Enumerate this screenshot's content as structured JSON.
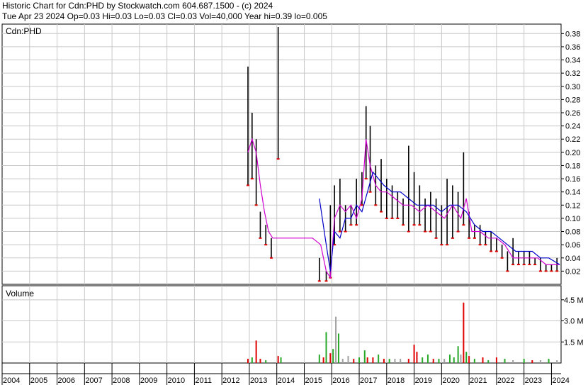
{
  "header": {
    "line1": "Historic Chart for Cdn:PHD by Stockwatch.com 604.687.1500 - (c) 2024",
    "line2": "Tue Apr 23 2024  Op=0.03  Hi=0.03  Lo=0.03  Cl=0.03  Vol=40,000  Year hi=0.39  lo=0.005"
  },
  "colors": {
    "grid": "#c8c8c8",
    "price_bar": "#000000",
    "down_marker": "#e00000",
    "ma_short": "#d000d0",
    "ma_long": "#0000c8",
    "vol_up": "#28a828",
    "vol_down": "#e00000",
    "vol_flat": "#a0a0a0"
  },
  "chart_data": [
    {
      "type": "line",
      "title": "Cdn:PHD",
      "ylim": [
        0,
        0.39
      ],
      "y_ticks": [
        "0.38",
        "0.36",
        "0.34",
        "0.32",
        "0.30",
        "0.28",
        "0.26",
        "0.24",
        "0.22",
        "0.20",
        "0.18",
        "0.16",
        "0.14",
        "0.12",
        "0.10",
        "0.08",
        "0.06",
        "0.04",
        "0.02"
      ],
      "x_ticks": [
        "2004",
        "2005",
        "2006",
        "2007",
        "2008",
        "2009",
        "2010",
        "2011",
        "2012",
        "2013",
        "2014",
        "2015",
        "2016",
        "2017",
        "2018",
        "2019",
        "2020",
        "2021",
        "2022",
        "2023",
        "2024"
      ],
      "price_bars": [
        {
          "x": 2012.95,
          "hi": 0.33,
          "lo": 0.15
        },
        {
          "x": 2013.1,
          "hi": 0.26,
          "lo": 0.16
        },
        {
          "x": 2013.25,
          "hi": 0.22,
          "lo": 0.12
        },
        {
          "x": 2013.4,
          "hi": 0.11,
          "lo": 0.07
        },
        {
          "x": 2013.6,
          "hi": 0.09,
          "lo": 0.06
        },
        {
          "x": 2013.8,
          "hi": 0.07,
          "lo": 0.04
        },
        {
          "x": 2014.05,
          "hi": 0.39,
          "lo": 0.19
        },
        {
          "x": 2015.55,
          "hi": 0.04,
          "lo": 0.005
        },
        {
          "x": 2015.8,
          "hi": 0.02,
          "lo": 0.005
        },
        {
          "x": 2015.95,
          "hi": 0.12,
          "lo": 0.01
        },
        {
          "x": 2016.1,
          "hi": 0.15,
          "lo": 0.06
        },
        {
          "x": 2016.3,
          "hi": 0.16,
          "lo": 0.08
        },
        {
          "x": 2016.5,
          "hi": 0.12,
          "lo": 0.08
        },
        {
          "x": 2016.7,
          "hi": 0.12,
          "lo": 0.09
        },
        {
          "x": 2016.9,
          "hi": 0.16,
          "lo": 0.09
        },
        {
          "x": 2017.1,
          "hi": 0.17,
          "lo": 0.12
        },
        {
          "x": 2017.25,
          "hi": 0.27,
          "lo": 0.16
        },
        {
          "x": 2017.4,
          "hi": 0.24,
          "lo": 0.14
        },
        {
          "x": 2017.6,
          "hi": 0.18,
          "lo": 0.12
        },
        {
          "x": 2017.8,
          "hi": 0.19,
          "lo": 0.11
        },
        {
          "x": 2018.0,
          "hi": 0.16,
          "lo": 0.1
        },
        {
          "x": 2018.2,
          "hi": 0.15,
          "lo": 0.1
        },
        {
          "x": 2018.4,
          "hi": 0.14,
          "lo": 0.1
        },
        {
          "x": 2018.6,
          "hi": 0.13,
          "lo": 0.09
        },
        {
          "x": 2018.8,
          "hi": 0.21,
          "lo": 0.08
        },
        {
          "x": 2019.0,
          "hi": 0.17,
          "lo": 0.09
        },
        {
          "x": 2019.2,
          "hi": 0.15,
          "lo": 0.09
        },
        {
          "x": 2019.4,
          "hi": 0.13,
          "lo": 0.08
        },
        {
          "x": 2019.6,
          "hi": 0.14,
          "lo": 0.08
        },
        {
          "x": 2019.8,
          "hi": 0.13,
          "lo": 0.07
        },
        {
          "x": 2020.0,
          "hi": 0.12,
          "lo": 0.06
        },
        {
          "x": 2020.2,
          "hi": 0.16,
          "lo": 0.06
        },
        {
          "x": 2020.4,
          "hi": 0.15,
          "lo": 0.07
        },
        {
          "x": 2020.6,
          "hi": 0.14,
          "lo": 0.08
        },
        {
          "x": 2020.8,
          "hi": 0.2,
          "lo": 0.09
        },
        {
          "x": 2021.0,
          "hi": 0.11,
          "lo": 0.07
        },
        {
          "x": 2021.2,
          "hi": 0.09,
          "lo": 0.07
        },
        {
          "x": 2021.4,
          "hi": 0.09,
          "lo": 0.06
        },
        {
          "x": 2021.6,
          "hi": 0.08,
          "lo": 0.06
        },
        {
          "x": 2021.8,
          "hi": 0.08,
          "lo": 0.05
        },
        {
          "x": 2022.0,
          "hi": 0.07,
          "lo": 0.05
        },
        {
          "x": 2022.2,
          "hi": 0.06,
          "lo": 0.04
        },
        {
          "x": 2022.4,
          "hi": 0.05,
          "lo": 0.02
        },
        {
          "x": 2022.6,
          "hi": 0.07,
          "lo": 0.03
        },
        {
          "x": 2022.8,
          "hi": 0.05,
          "lo": 0.03
        },
        {
          "x": 2023.0,
          "hi": 0.05,
          "lo": 0.03
        },
        {
          "x": 2023.2,
          "hi": 0.05,
          "lo": 0.03
        },
        {
          "x": 2023.4,
          "hi": 0.04,
          "lo": 0.03
        },
        {
          "x": 2023.6,
          "hi": 0.04,
          "lo": 0.02
        },
        {
          "x": 2023.8,
          "hi": 0.03,
          "lo": 0.02
        },
        {
          "x": 2024.0,
          "hi": 0.03,
          "lo": 0.02
        },
        {
          "x": 2024.2,
          "hi": 0.04,
          "lo": 0.02
        }
      ],
      "series": [
        {
          "x": [
            2012.95,
            2013.1,
            2013.25,
            2013.4,
            2013.55,
            2013.7,
            2013.85,
            2014.05,
            2015.3,
            2015.6,
            2015.8,
            2015.95,
            2016.1,
            2016.3,
            2016.5,
            2016.7,
            2016.9,
            2017.1,
            2017.25,
            2017.4,
            2017.6,
            2017.8,
            2018.0,
            2018.3,
            2018.6,
            2018.9,
            2019.2,
            2019.5,
            2019.8,
            2020.1,
            2020.4,
            2020.7,
            2020.9,
            2021.1,
            2021.4,
            2021.7,
            2022.0,
            2022.3,
            2022.6,
            2022.9,
            2023.2,
            2023.5,
            2023.8,
            2024.1,
            2024.3
          ],
          "y": [
            0.2,
            0.22,
            0.2,
            0.15,
            0.11,
            0.08,
            0.07,
            0.07,
            0.07,
            0.06,
            0.02,
            0.01,
            0.1,
            0.12,
            0.11,
            0.12,
            0.1,
            0.13,
            0.22,
            0.18,
            0.15,
            0.14,
            0.14,
            0.13,
            0.12,
            0.12,
            0.11,
            0.12,
            0.11,
            0.1,
            0.12,
            0.1,
            0.13,
            0.08,
            0.08,
            0.07,
            0.07,
            0.06,
            0.04,
            0.04,
            0.04,
            0.04,
            0.03,
            0.03,
            0.03
          ]
        },
        {
          "x": [
            2015.55,
            2015.8,
            2015.95,
            2016.1,
            2016.3,
            2016.5,
            2016.7,
            2016.9,
            2017.1,
            2017.3,
            2017.5,
            2017.7,
            2017.9,
            2018.2,
            2018.5,
            2018.8,
            2019.1,
            2019.4,
            2019.7,
            2020.0,
            2020.3,
            2020.6,
            2020.9,
            2021.2,
            2021.5,
            2021.8,
            2022.1,
            2022.4,
            2022.7,
            2023.0,
            2023.3,
            2023.6,
            2023.9,
            2024.3
          ],
          "y": [
            0.13,
            0.06,
            0.02,
            0.08,
            0.07,
            0.1,
            0.1,
            0.12,
            0.11,
            0.14,
            0.17,
            0.16,
            0.15,
            0.14,
            0.14,
            0.13,
            0.12,
            0.12,
            0.12,
            0.11,
            0.12,
            0.12,
            0.11,
            0.09,
            0.08,
            0.08,
            0.07,
            0.06,
            0.05,
            0.05,
            0.05,
            0.04,
            0.04,
            0.03
          ]
        }
      ]
    },
    {
      "type": "bar",
      "title": "Volume",
      "ylim": [
        0,
        5.5
      ],
      "y_ticks": [
        "4.5 M",
        "3.0 M",
        "1.5 M"
      ],
      "bars": [
        {
          "x": 2012.95,
          "v": 0.3,
          "dir": "down"
        },
        {
          "x": 2013.1,
          "v": 0.4,
          "dir": "up"
        },
        {
          "x": 2013.25,
          "v": 1.6,
          "dir": "down"
        },
        {
          "x": 2013.4,
          "v": 0.3,
          "dir": "down"
        },
        {
          "x": 2013.6,
          "v": 0.2,
          "dir": "up"
        },
        {
          "x": 2014.05,
          "v": 0.5,
          "dir": "down"
        },
        {
          "x": 2014.15,
          "v": 0.4,
          "dir": "up"
        },
        {
          "x": 2015.55,
          "v": 0.6,
          "dir": "up"
        },
        {
          "x": 2015.7,
          "v": 0.4,
          "dir": "down"
        },
        {
          "x": 2015.8,
          "v": 2.2,
          "dir": "up"
        },
        {
          "x": 2015.95,
          "v": 0.7,
          "dir": "down"
        },
        {
          "x": 2016.05,
          "v": 1.0,
          "dir": "up"
        },
        {
          "x": 2016.15,
          "v": 3.3,
          "dir": "flat"
        },
        {
          "x": 2016.25,
          "v": 2.1,
          "dir": "up"
        },
        {
          "x": 2016.4,
          "v": 0.3,
          "dir": "flat"
        },
        {
          "x": 2016.6,
          "v": 0.5,
          "dir": "flat"
        },
        {
          "x": 2016.8,
          "v": 0.3,
          "dir": "down"
        },
        {
          "x": 2017.0,
          "v": 0.4,
          "dir": "up"
        },
        {
          "x": 2017.2,
          "v": 0.9,
          "dir": "up"
        },
        {
          "x": 2017.3,
          "v": 0.4,
          "dir": "down"
        },
        {
          "x": 2017.5,
          "v": 0.4,
          "dir": "down"
        },
        {
          "x": 2017.7,
          "v": 0.6,
          "dir": "up"
        },
        {
          "x": 2017.9,
          "v": 0.3,
          "dir": "down"
        },
        {
          "x": 2018.1,
          "v": 0.3,
          "dir": "up"
        },
        {
          "x": 2018.3,
          "v": 0.3,
          "dir": "flat"
        },
        {
          "x": 2018.5,
          "v": 0.3,
          "dir": "flat"
        },
        {
          "x": 2018.8,
          "v": 0.3,
          "dir": "down"
        },
        {
          "x": 2019.0,
          "v": 1.3,
          "dir": "down"
        },
        {
          "x": 2019.1,
          "v": 0.8,
          "dir": "down"
        },
        {
          "x": 2019.3,
          "v": 0.4,
          "dir": "up"
        },
        {
          "x": 2019.5,
          "v": 0.6,
          "dir": "up"
        },
        {
          "x": 2019.7,
          "v": 0.3,
          "dir": "down"
        },
        {
          "x": 2019.9,
          "v": 0.3,
          "dir": "up"
        },
        {
          "x": 2020.1,
          "v": 0.3,
          "dir": "flat"
        },
        {
          "x": 2020.3,
          "v": 0.6,
          "dir": "up"
        },
        {
          "x": 2020.45,
          "v": 0.4,
          "dir": "up"
        },
        {
          "x": 2020.6,
          "v": 1.2,
          "dir": "up"
        },
        {
          "x": 2020.7,
          "v": 0.6,
          "dir": "flat"
        },
        {
          "x": 2020.8,
          "v": 4.3,
          "dir": "down"
        },
        {
          "x": 2020.9,
          "v": 0.8,
          "dir": "up"
        },
        {
          "x": 2021.0,
          "v": 0.5,
          "dir": "down"
        },
        {
          "x": 2021.2,
          "v": 0.3,
          "dir": "up"
        },
        {
          "x": 2021.5,
          "v": 0.4,
          "dir": "down"
        },
        {
          "x": 2021.7,
          "v": 0.2,
          "dir": "up"
        },
        {
          "x": 2022.0,
          "v": 0.4,
          "dir": "down"
        },
        {
          "x": 2022.3,
          "v": 0.3,
          "dir": "up"
        },
        {
          "x": 2022.6,
          "v": 0.2,
          "dir": "flat"
        },
        {
          "x": 2023.0,
          "v": 0.3,
          "dir": "up"
        },
        {
          "x": 2023.3,
          "v": 0.2,
          "dir": "down"
        },
        {
          "x": 2023.6,
          "v": 0.2,
          "dir": "flat"
        },
        {
          "x": 2023.9,
          "v": 0.3,
          "dir": "up"
        },
        {
          "x": 2024.2,
          "v": 0.2,
          "dir": "flat"
        }
      ]
    }
  ]
}
